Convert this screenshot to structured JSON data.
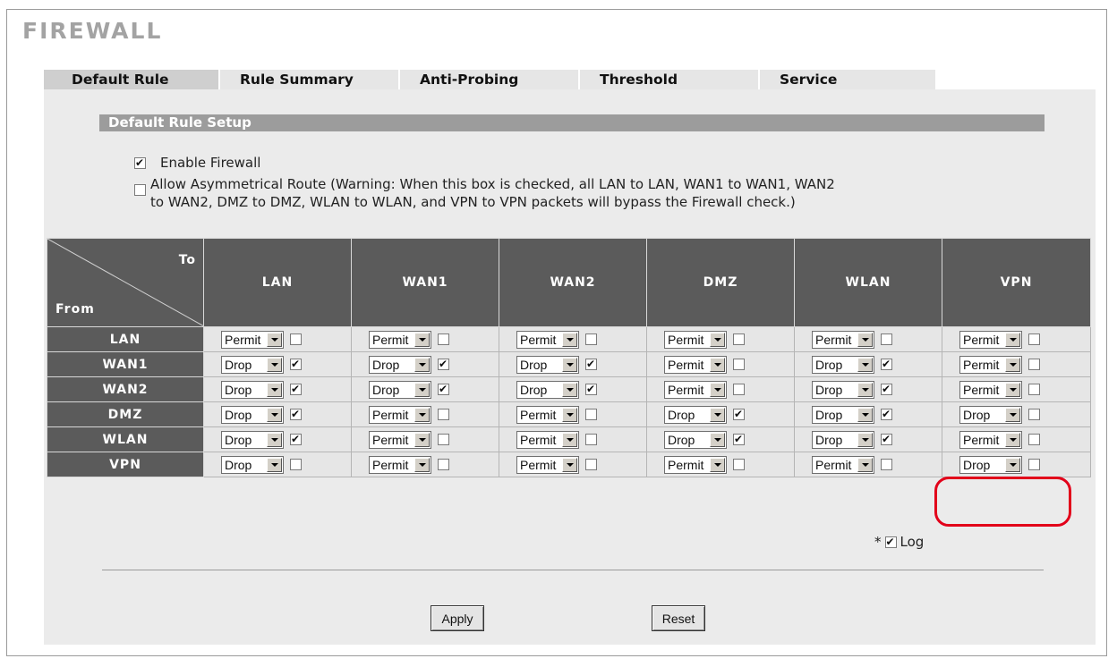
{
  "page": {
    "title": "FIREWALL"
  },
  "tabs": [
    {
      "label": "Default Rule",
      "active": true
    },
    {
      "label": "Rule Summary",
      "active": false
    },
    {
      "label": "Anti-Probing",
      "active": false
    },
    {
      "label": "Threshold",
      "active": false
    },
    {
      "label": "Service",
      "active": false
    }
  ],
  "section": {
    "title": "Default Rule Setup"
  },
  "options": {
    "enable_firewall": {
      "label": "Enable Firewall",
      "checked": true
    },
    "asymmetrical": {
      "line1": "Allow Asymmetrical Route (Warning: When this box is checked, all LAN to LAN, WAN1 to WAN1, WAN2",
      "line2": "to WAN2, DMZ to DMZ, WLAN to WLAN, and VPN to VPN packets will bypass the Firewall check.)",
      "checked": false
    }
  },
  "matrix": {
    "corner_to": "To",
    "corner_from": "From",
    "columns": [
      "LAN",
      "WAN1",
      "WAN2",
      "DMZ",
      "WLAN",
      "VPN"
    ],
    "rows": [
      {
        "name": "LAN",
        "cells": [
          {
            "action": "Permit",
            "log": false
          },
          {
            "action": "Permit",
            "log": false
          },
          {
            "action": "Permit",
            "log": false
          },
          {
            "action": "Permit",
            "log": false
          },
          {
            "action": "Permit",
            "log": false
          },
          {
            "action": "Permit",
            "log": false
          }
        ]
      },
      {
        "name": "WAN1",
        "cells": [
          {
            "action": "Drop",
            "log": true
          },
          {
            "action": "Drop",
            "log": true
          },
          {
            "action": "Drop",
            "log": true
          },
          {
            "action": "Permit",
            "log": false
          },
          {
            "action": "Drop",
            "log": true
          },
          {
            "action": "Permit",
            "log": false
          }
        ]
      },
      {
        "name": "WAN2",
        "cells": [
          {
            "action": "Drop",
            "log": true
          },
          {
            "action": "Drop",
            "log": true
          },
          {
            "action": "Drop",
            "log": true
          },
          {
            "action": "Permit",
            "log": false
          },
          {
            "action": "Drop",
            "log": true
          },
          {
            "action": "Permit",
            "log": false
          }
        ]
      },
      {
        "name": "DMZ",
        "cells": [
          {
            "action": "Drop",
            "log": true
          },
          {
            "action": "Permit",
            "log": false
          },
          {
            "action": "Permit",
            "log": false
          },
          {
            "action": "Drop",
            "log": true
          },
          {
            "action": "Drop",
            "log": true
          },
          {
            "action": "Drop",
            "log": false
          }
        ]
      },
      {
        "name": "WLAN",
        "cells": [
          {
            "action": "Drop",
            "log": true
          },
          {
            "action": "Permit",
            "log": false
          },
          {
            "action": "Permit",
            "log": false
          },
          {
            "action": "Drop",
            "log": true
          },
          {
            "action": "Drop",
            "log": true
          },
          {
            "action": "Permit",
            "log": false
          }
        ]
      },
      {
        "name": "VPN",
        "cells": [
          {
            "action": "Drop",
            "log": false
          },
          {
            "action": "Permit",
            "log": false
          },
          {
            "action": "Permit",
            "log": false
          },
          {
            "action": "Permit",
            "log": false
          },
          {
            "action": "Permit",
            "log": false
          },
          {
            "action": "Drop",
            "log": false
          }
        ]
      }
    ]
  },
  "legend": {
    "prefix": "*",
    "label": "Log",
    "checked": true
  },
  "buttons": {
    "apply": "Apply",
    "reset": "Reset"
  },
  "colors": {
    "header_bg": "#5b5b5b",
    "section_bar": "#9c9c9c",
    "panel_bg": "#ebebeb",
    "highlight": "#e2001a"
  }
}
